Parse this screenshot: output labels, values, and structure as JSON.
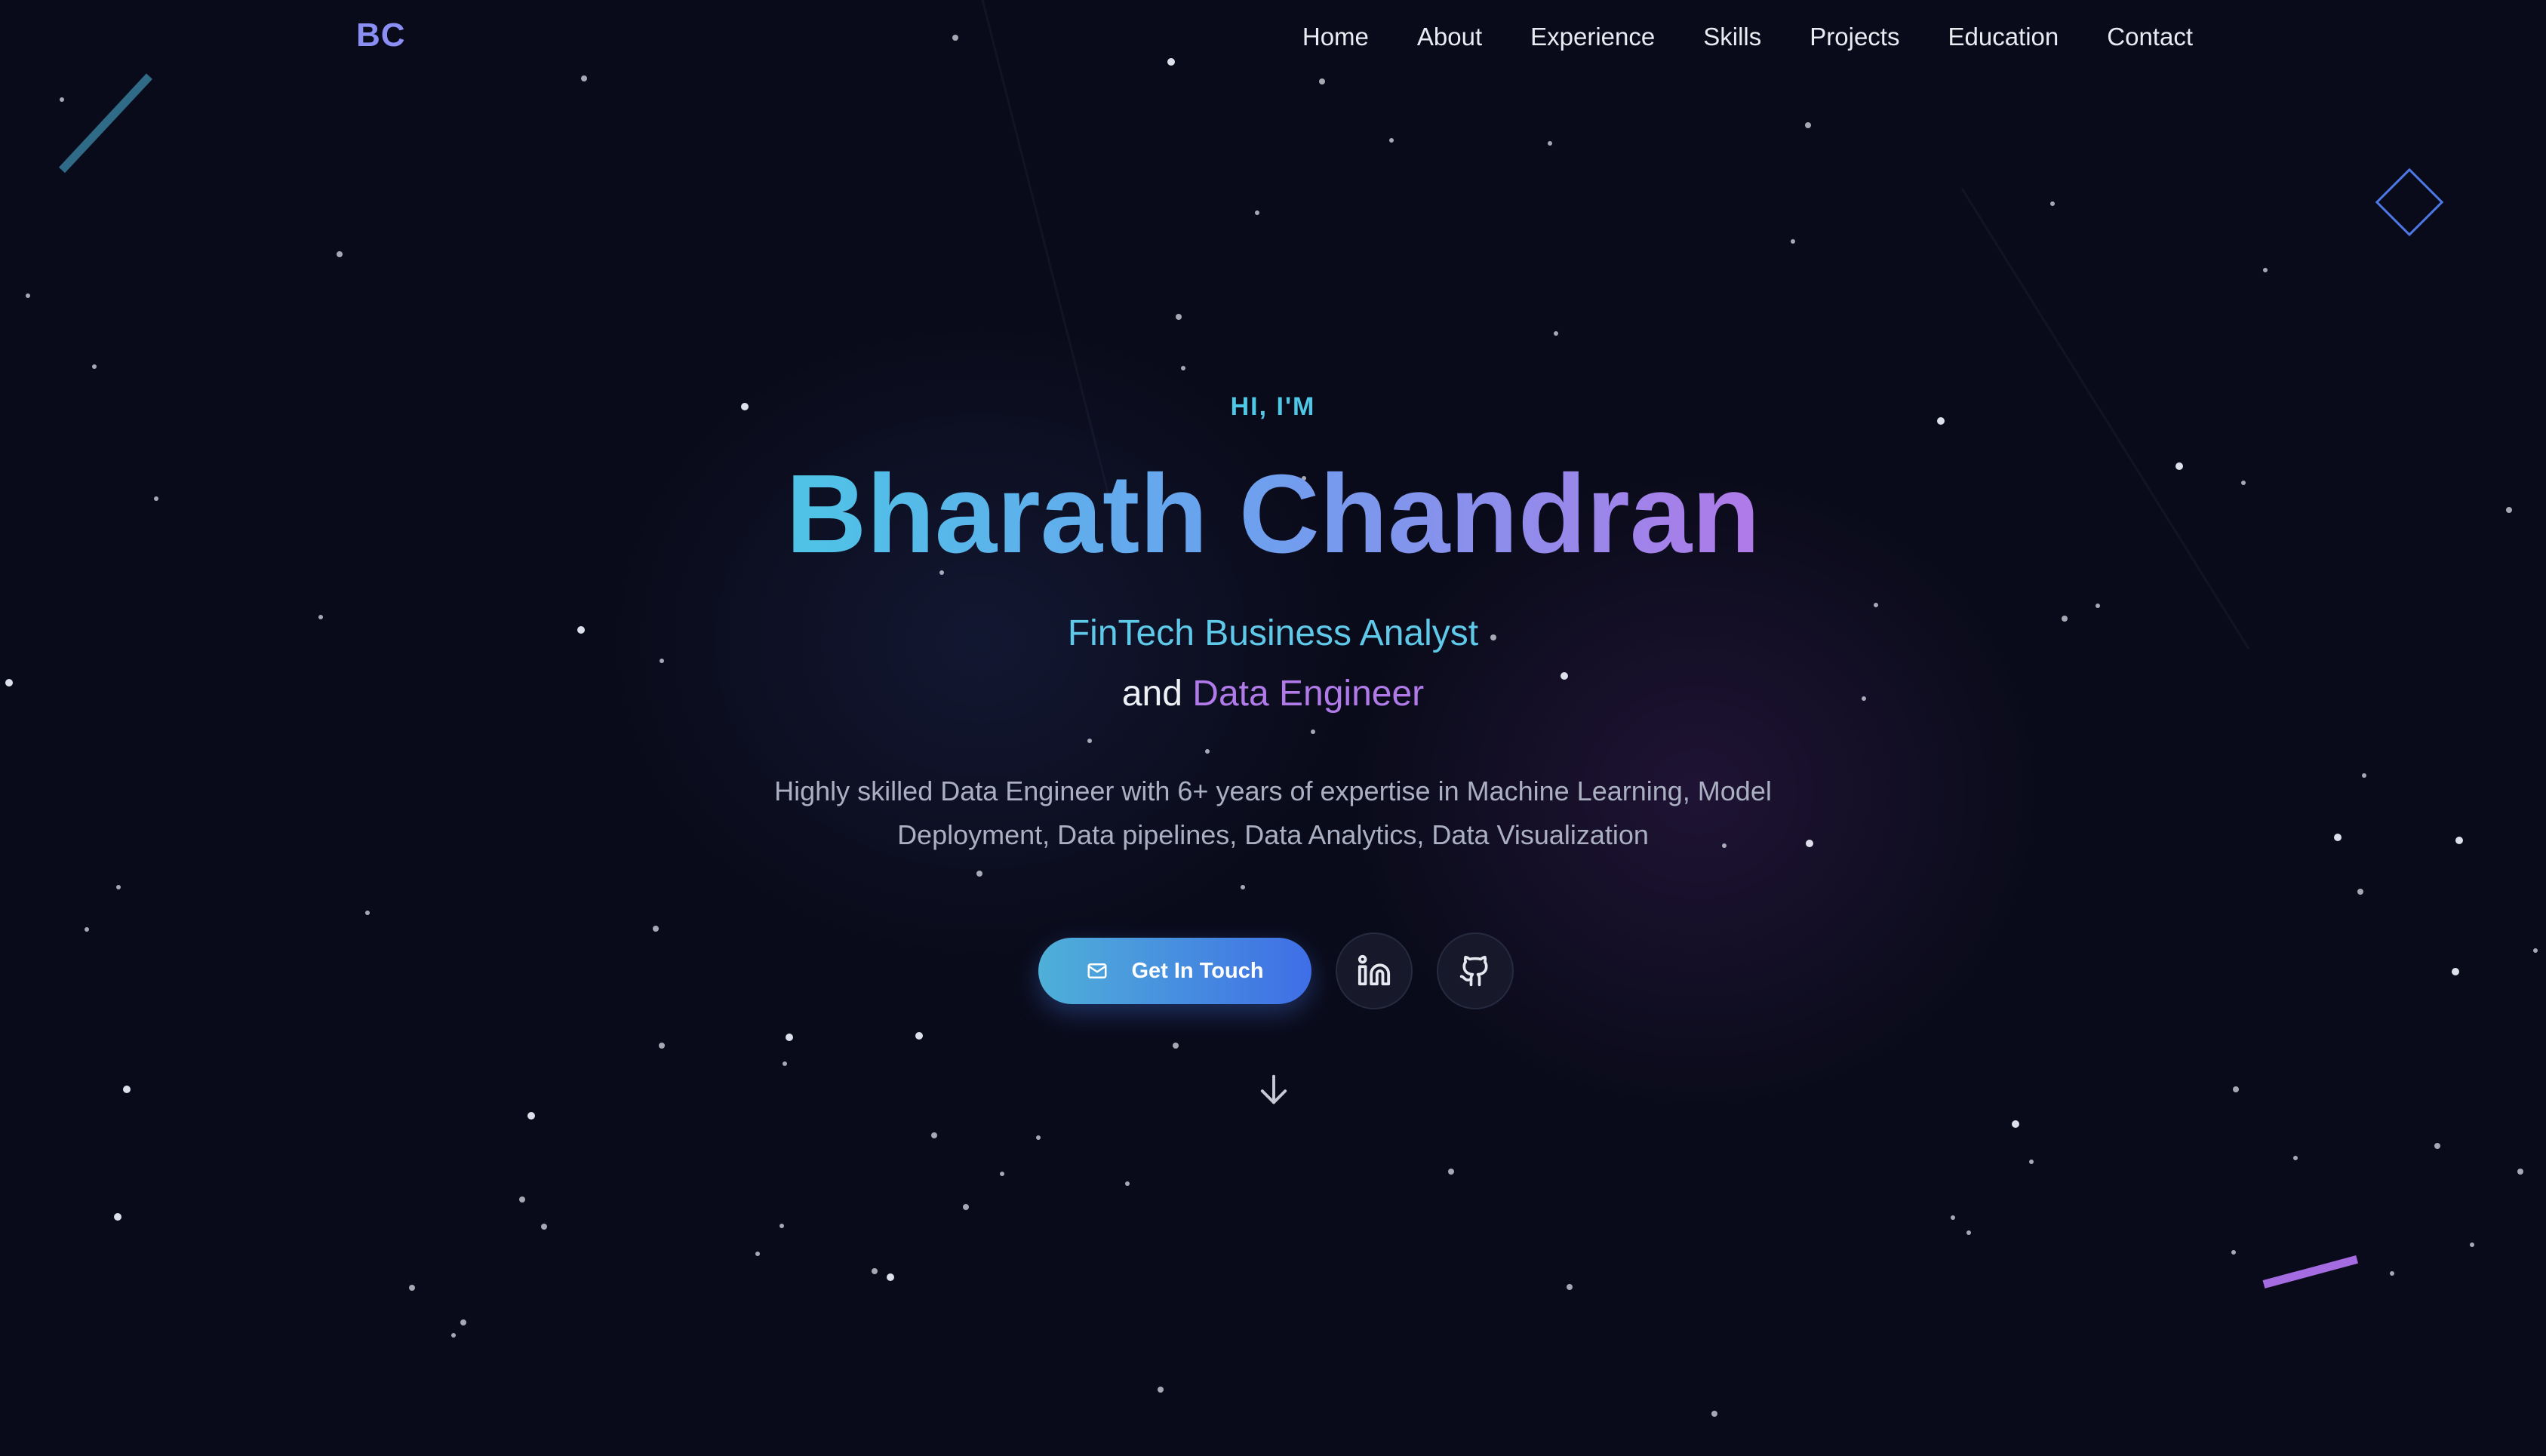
{
  "logo": "BC",
  "nav": {
    "items": [
      "Home",
      "About",
      "Experience",
      "Skills",
      "Projects",
      "Education",
      "Contact"
    ]
  },
  "hero": {
    "eyebrow": "HI, I'M",
    "name": "Bharath Chandran",
    "role_primary": "FinTech Business Analyst",
    "role_connector": "and",
    "role_secondary": "Data Engineer",
    "description": "Highly skilled Data Engineer with 6+ years of expertise in Machine Learning, Model Deployment, Data pipelines, Data Analytics, Data Visualization",
    "cta_label": "Get In Touch"
  },
  "icons": {
    "cta": "mail-icon",
    "linkedin": "linkedin-icon",
    "github": "github-icon",
    "scroll": "arrow-down-icon"
  },
  "colors": {
    "background": "#0a0b1a",
    "logo": "#8b8ff5",
    "accent_cyan": "#4fc8e8",
    "accent_purple": "#b07ae8",
    "cta_start": "#4fb0d8",
    "cta_end": "#3f6ee6"
  }
}
